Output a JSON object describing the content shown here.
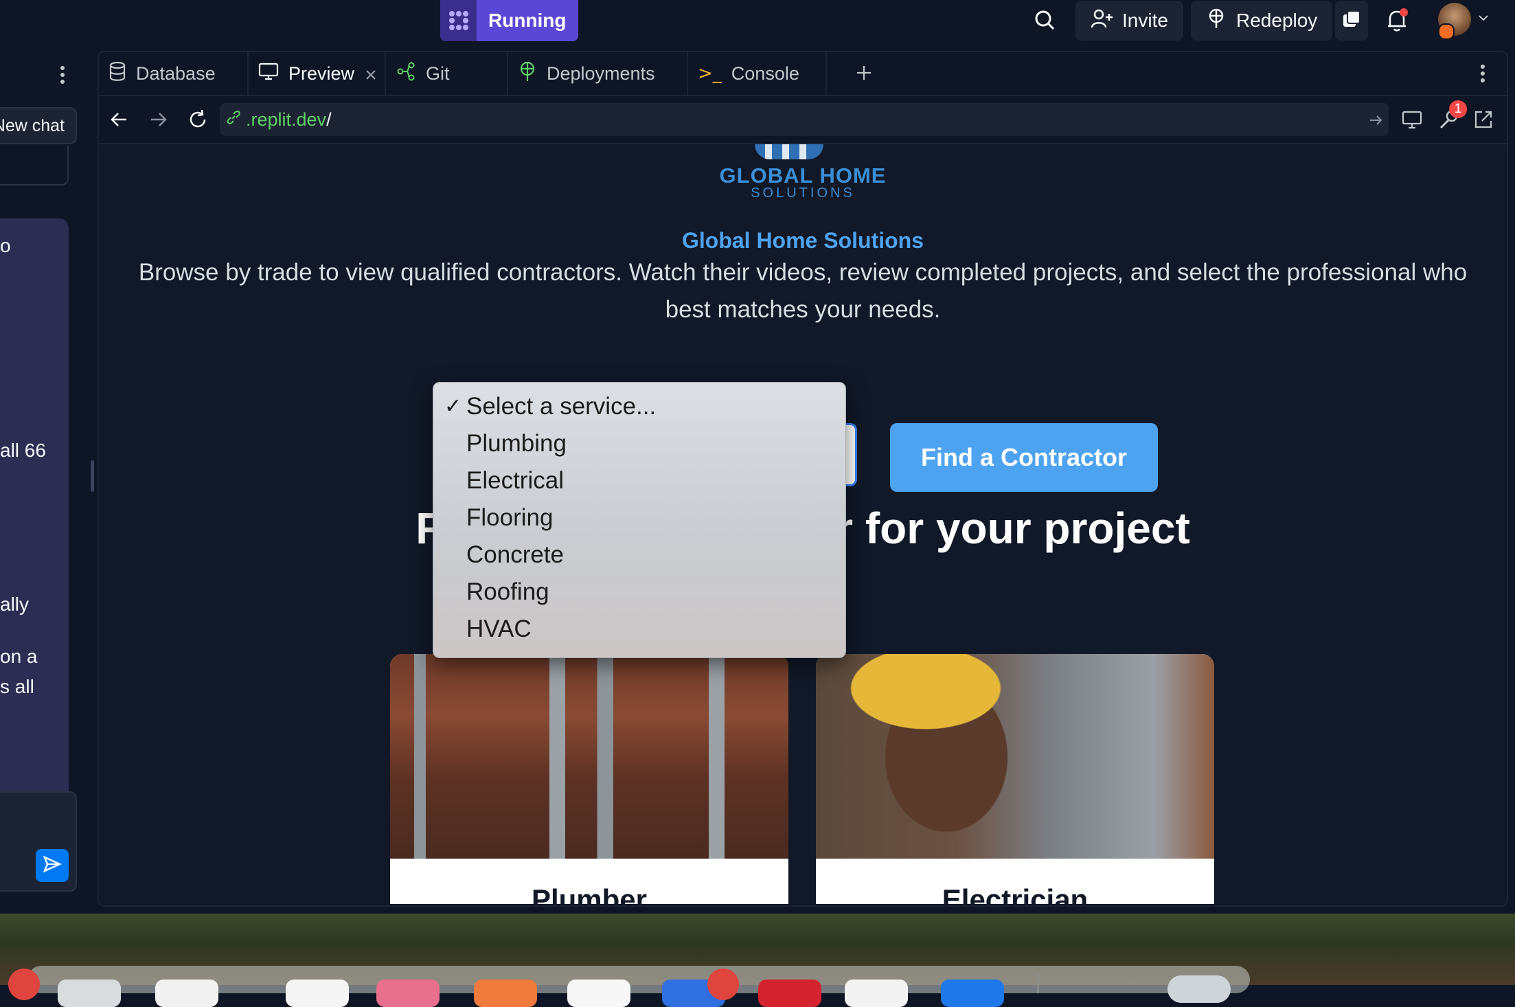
{
  "topbar": {
    "run_label": "Running",
    "invite_label": "Invite",
    "redeploy_label": "Redeploy"
  },
  "left_panel": {
    "new_chat_label": "New chat",
    "chat_fragments": [
      "o",
      "all 66",
      "ally",
      "on a",
      "s all"
    ]
  },
  "tabs": [
    {
      "label": "Database",
      "icon": "database-icon"
    },
    {
      "label": "Preview",
      "icon": "monitor-icon"
    },
    {
      "label": "Git",
      "icon": "git-icon"
    },
    {
      "label": "Deployments",
      "icon": "deploy-icon"
    },
    {
      "label": "Console",
      "icon": "terminal-icon"
    }
  ],
  "urlbar": {
    "url": ".replit.dev",
    "url_suffix": "/",
    "notification_count": "1"
  },
  "site": {
    "logo_line1": "GLOBAL HOME",
    "logo_line2": "SOLUTIONS",
    "brand": "Global Home Solutions",
    "intro": "Browse by trade to view qualified contractors. Watch their videos, review completed projects, and select the professional who best matches your needs.",
    "find_button": "Find a Contractor",
    "heading_left": "Fi",
    "heading_right": "or for your project",
    "cards": [
      {
        "title": "Plumber"
      },
      {
        "title": "Electrician"
      }
    ]
  },
  "dropdown": {
    "selected": "Select a service...",
    "options": [
      "Select a service...",
      "Plumbing",
      "Electrical",
      "Flooring",
      "Concrete",
      "Roofing",
      "HVAC"
    ]
  },
  "colors": {
    "accent": "#4ea3f0",
    "running_bg": "#5b47d6",
    "ide_bg": "#0e1525",
    "site_bg": "#111827"
  }
}
